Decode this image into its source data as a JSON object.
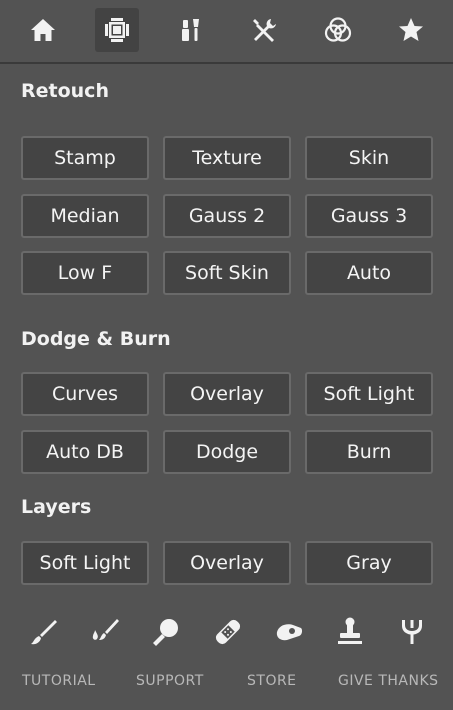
{
  "tabs": [
    {
      "icon": "home-icon",
      "active": false
    },
    {
      "icon": "crop-frame-icon",
      "active": true
    },
    {
      "icon": "makeup-brush-icon",
      "active": false
    },
    {
      "icon": "tools-icon",
      "active": false
    },
    {
      "icon": "color-circles-icon",
      "active": false
    },
    {
      "icon": "star-icon",
      "active": false
    }
  ],
  "sections": {
    "retouch": {
      "title": "Retouch",
      "buttons": [
        "Stamp",
        "Texture",
        "Skin",
        "Median",
        "Gauss 2",
        "Gauss 3",
        "Low F",
        "Soft Skin",
        "Auto"
      ]
    },
    "dodge_burn": {
      "title": "Dodge & Burn",
      "buttons": [
        "Curves",
        "Overlay",
        "Soft Light",
        "Auto DB",
        "Dodge",
        "Burn"
      ]
    },
    "layers": {
      "title": "Layers",
      "buttons": [
        "Soft Light",
        "Overlay",
        "Gray"
      ]
    }
  },
  "tools": [
    {
      "icon": "brush-icon"
    },
    {
      "icon": "drop-brush-icon"
    },
    {
      "icon": "magnifier-icon"
    },
    {
      "icon": "bandage-icon"
    },
    {
      "icon": "eraser-icon"
    },
    {
      "icon": "stamp-icon"
    },
    {
      "icon": "fork-icon"
    }
  ],
  "footer": {
    "tutorial": "TUTORIAL",
    "support": "SUPPORT",
    "store": "STORE",
    "thanks": "GIVE THANKS"
  }
}
